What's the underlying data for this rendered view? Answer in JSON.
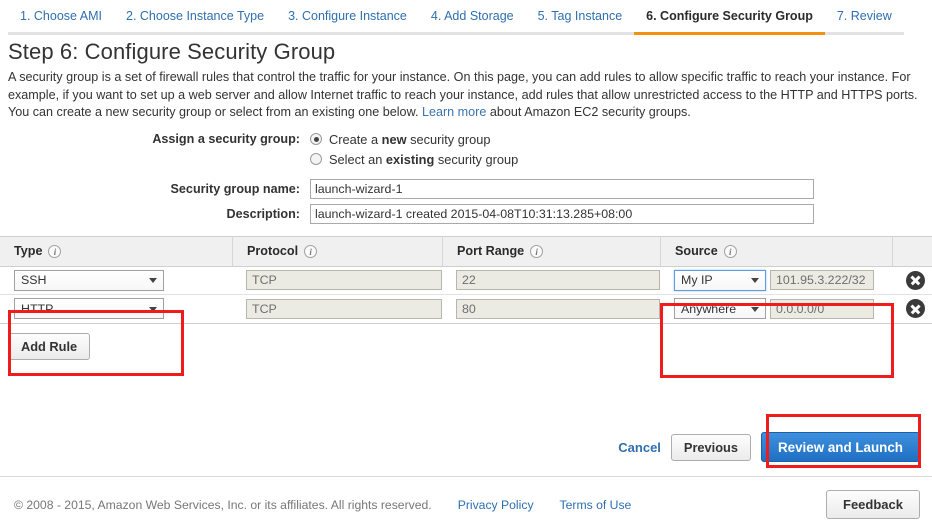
{
  "wizard": {
    "tabs": [
      {
        "label": "1. Choose AMI",
        "active": false
      },
      {
        "label": "2. Choose Instance Type",
        "active": false
      },
      {
        "label": "3. Configure Instance",
        "active": false
      },
      {
        "label": "4. Add Storage",
        "active": false
      },
      {
        "label": "5. Tag Instance",
        "active": false
      },
      {
        "label": "6. Configure Security Group",
        "active": true
      },
      {
        "label": "7. Review",
        "active": false
      }
    ],
    "active_tab_color": "#f29111"
  },
  "page": {
    "title": "Step 6: Configure Security Group",
    "intro_part1": "A security group is a set of firewall rules that control the traffic for your instance. On this page, you can add rules to allow specific traffic to reach your instance. For example, if you want to set up a web server and allow Internet traffic to reach your instance, add rules that allow unrestricted access to the HTTP and HTTPS ports. You can create a new security group or select from an existing one below.",
    "intro_link": "Learn more",
    "intro_part2": "about Amazon EC2 security groups."
  },
  "form": {
    "assign_label": "Assign a security group:",
    "radio_new": {
      "text_before": "Create a ",
      "bold": "new",
      "text_after": " security group",
      "selected": true
    },
    "radio_existing": {
      "text_before": "Select an ",
      "bold": "existing",
      "text_after": " security group",
      "selected": false
    },
    "name_label": "Security group name:",
    "name_value": "launch-wizard-1",
    "description_label": "Description:",
    "description_value": "launch-wizard-1 created 2015-04-08T10:31:13.285+08:00"
  },
  "rules_table": {
    "columns": [
      "Type",
      "Protocol",
      "Port Range",
      "Source"
    ],
    "rows": [
      {
        "type": "SSH",
        "protocol": "TCP",
        "port": "22",
        "source": "My IP",
        "cidr": "101.95.3.222/32",
        "source_focused": true
      },
      {
        "type": "HTTP",
        "protocol": "TCP",
        "port": "80",
        "source": "Anywhere",
        "cidr": "0.0.0.0/0",
        "source_focused": false
      }
    ]
  },
  "buttons": {
    "add_rule": "Add Rule",
    "cancel": "Cancel",
    "previous": "Previous",
    "review_and_launch": "Review and Launch",
    "feedback": "Feedback"
  },
  "footer": {
    "copyright": "© 2008 - 2015, Amazon Web Services, Inc. or its affiliates. All rights reserved.",
    "privacy": "Privacy Policy",
    "terms": "Terms of Use"
  },
  "annotations": {
    "color": "#ee1c1c",
    "boxes": [
      "type-column",
      "source-column",
      "review-and-launch-button"
    ]
  }
}
